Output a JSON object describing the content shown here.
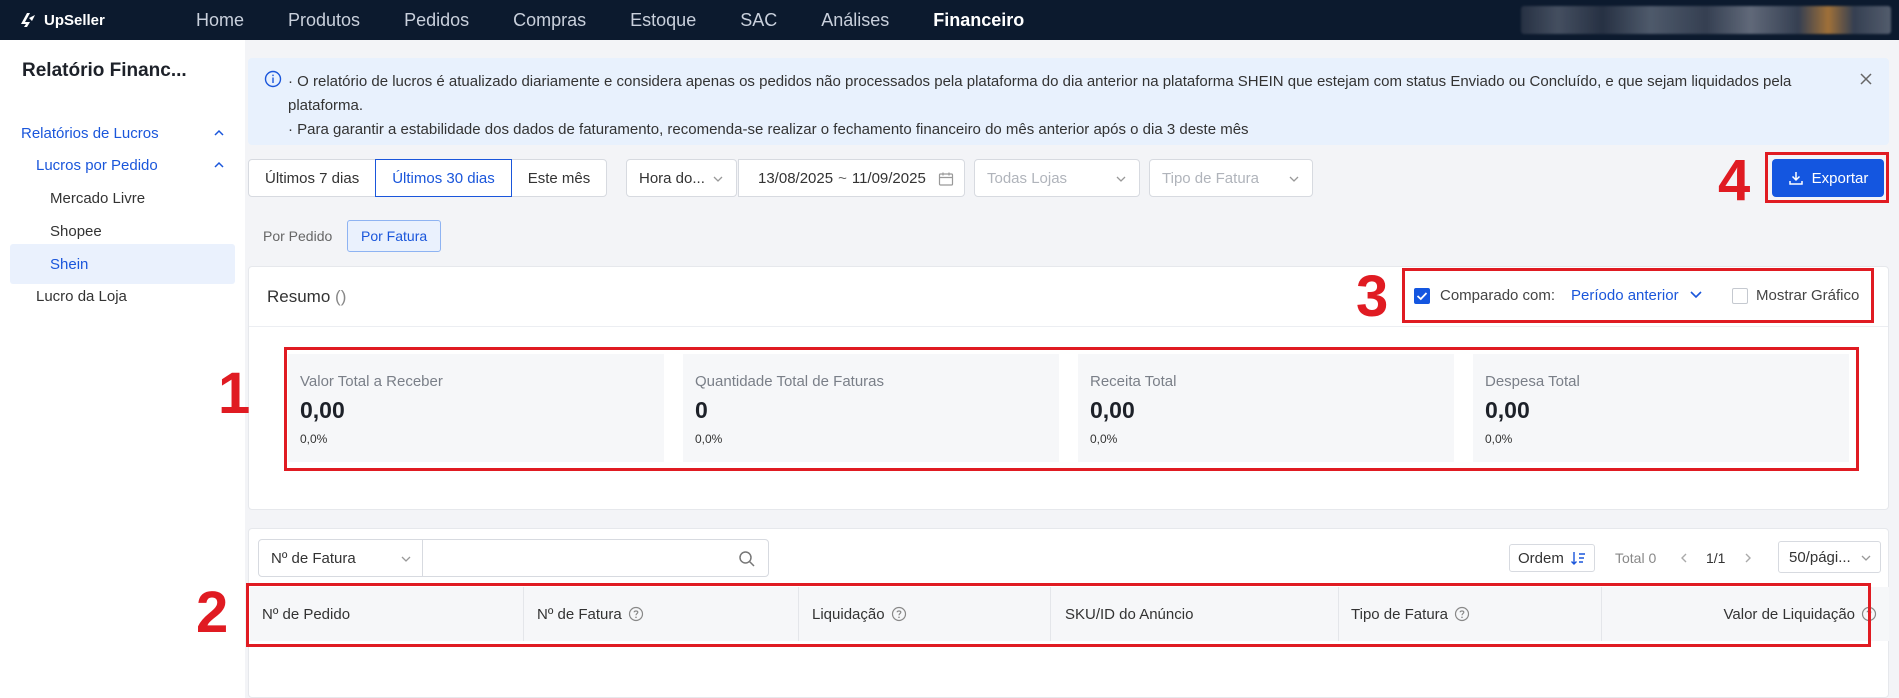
{
  "nav": {
    "logo_text": "UpSeller",
    "items": [
      "Home",
      "Produtos",
      "Pedidos",
      "Compras",
      "Estoque",
      "SAC",
      "Análises",
      "Financeiro"
    ],
    "active": "Financeiro"
  },
  "sidebar": {
    "title": "Relatório Financ...",
    "group": "Relatórios de Lucros",
    "subgroup": "Lucros por Pedido",
    "items": [
      "Mercado Livre",
      "Shopee",
      "Shein"
    ],
    "selected": "Shein",
    "other": "Lucro da Loja"
  },
  "notice": {
    "line1": "· O relatório de lucros é atualizado diariamente e considera apenas os pedidos não processados pela plataforma do dia anterior na plataforma SHEIN que estejam com status Enviado ou Concluído, e que sejam liquidados pela plataforma.",
    "line2": "· Para garantir a estabilidade dos dados de faturamento, recomenda-se realizar o fechamento financeiro do mês anterior após o dia 3 deste mês"
  },
  "filters": {
    "periods": [
      "Últimos 7 dias",
      "Últimos 30 dias",
      "Este mês"
    ],
    "active_period": "Últimos 30 dias",
    "time_type": "Hora do...",
    "date_start": "13/08/2025",
    "date_sep": "~",
    "date_end": "11/09/2025",
    "stores_placeholder": "Todas Lojas",
    "invoice_type_placeholder": "Tipo de Fatura",
    "export_label": "Exportar"
  },
  "subtabs": [
    "Por Pedido",
    "Por Fatura"
  ],
  "active_subtab": "Por Fatura",
  "summary": {
    "title": "Resumo",
    "title_suffix": "()",
    "compare_label": "Comparado com:",
    "compare_value": "Período anterior",
    "compare_checked": true,
    "show_chart_label": "Mostrar Gráfico",
    "show_chart_checked": false,
    "metrics": [
      {
        "label": "Valor Total a Receber",
        "value": "0,00",
        "change": "0,0%"
      },
      {
        "label": "Quantidade Total de Faturas",
        "value": "0",
        "change": "0,0%"
      },
      {
        "label": "Receita Total",
        "value": "0,00",
        "change": "0,0%"
      },
      {
        "label": "Despesa Total",
        "value": "0,00",
        "change": "0,0%"
      }
    ]
  },
  "table": {
    "search_field": "Nº de Fatura",
    "search_value": "",
    "order_label": "Ordem",
    "total_label": "Total 0",
    "page": "1/1",
    "page_size": "50/pági...",
    "columns": [
      "Nº de Pedido",
      "Nº de Fatura",
      "Liquidação",
      "SKU/ID do Anúncio",
      "Tipo de Fatura",
      "Valor de Liquidação"
    ]
  },
  "annotations": [
    "1",
    "2",
    "3",
    "4"
  ],
  "colors": {
    "accent": "#1456e0",
    "annotation": "#e01b22",
    "nav_bg": "#0c1a2e"
  }
}
